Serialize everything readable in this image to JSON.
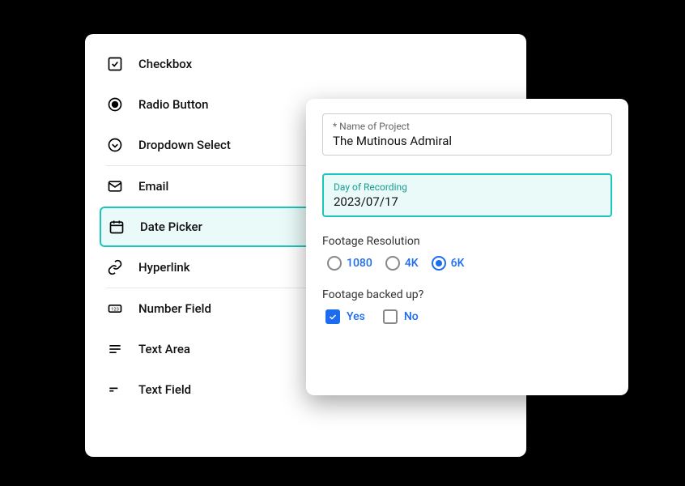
{
  "fieldTypes": {
    "checkbox": "Checkbox",
    "radio": "Radio Button",
    "dropdown": "Dropdown Select",
    "email": "Email",
    "date": "Date Picker",
    "hyperlink": "Hyperlink",
    "number": "Number Field",
    "textarea": "Text Area",
    "textfield": "Text Field"
  },
  "form": {
    "project": {
      "label": "* Name of Project",
      "value": "The Mutinous Admiral"
    },
    "recording": {
      "label": "Day of Recording",
      "value": "2023/07/17"
    },
    "resolution": {
      "label": "Footage Resolution",
      "opt1": "1080",
      "opt2": "4K",
      "opt3": "6K"
    },
    "backup": {
      "label": "Footage backed up?",
      "yes": "Yes",
      "no": "No"
    }
  }
}
